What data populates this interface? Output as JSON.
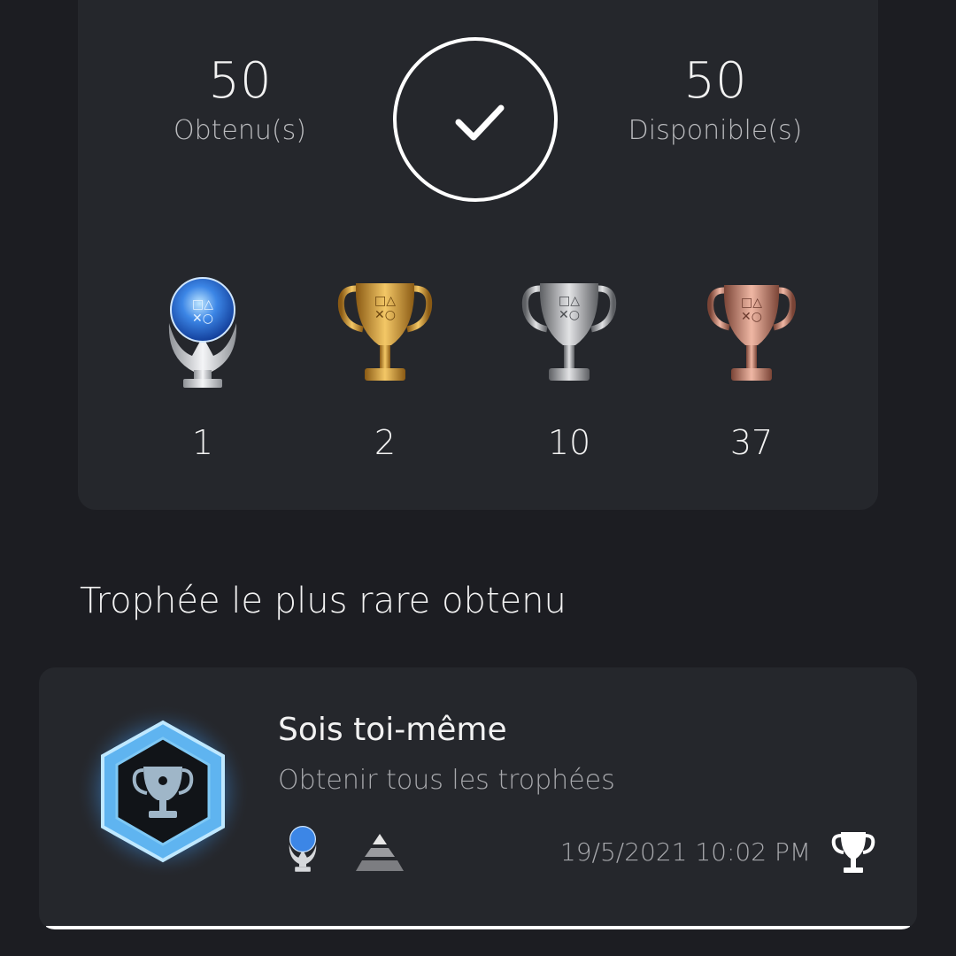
{
  "summary": {
    "earned_value": "50",
    "earned_label": "Obtenu(s)",
    "available_value": "50",
    "available_label": "Disponible(s)",
    "completion_icon": "check-icon"
  },
  "grades": [
    {
      "name": "platinum",
      "icon": "platinum-trophy-icon",
      "count": "1",
      "color": "#3a7fe0"
    },
    {
      "name": "gold",
      "icon": "gold-trophy-icon",
      "count": "2",
      "color": "#d9a441"
    },
    {
      "name": "silver",
      "icon": "silver-trophy-icon",
      "count": "10",
      "color": "#b8b9bc"
    },
    {
      "name": "bronze",
      "icon": "bronze-trophy-icon",
      "count": "37",
      "color": "#c98b78"
    }
  ],
  "rarest": {
    "section_title": "Trophée le plus rare obtenu",
    "trophy_name": "Sois toi-même",
    "trophy_description": "Obtenir tous les trophées",
    "grade_icon": "platinum-trophy-icon",
    "rarity_icon": "ultra-rare-pyramid-icon",
    "earned_date": "19/5/2021  10:02 PM",
    "status_icon": "trophy-outline-icon"
  }
}
